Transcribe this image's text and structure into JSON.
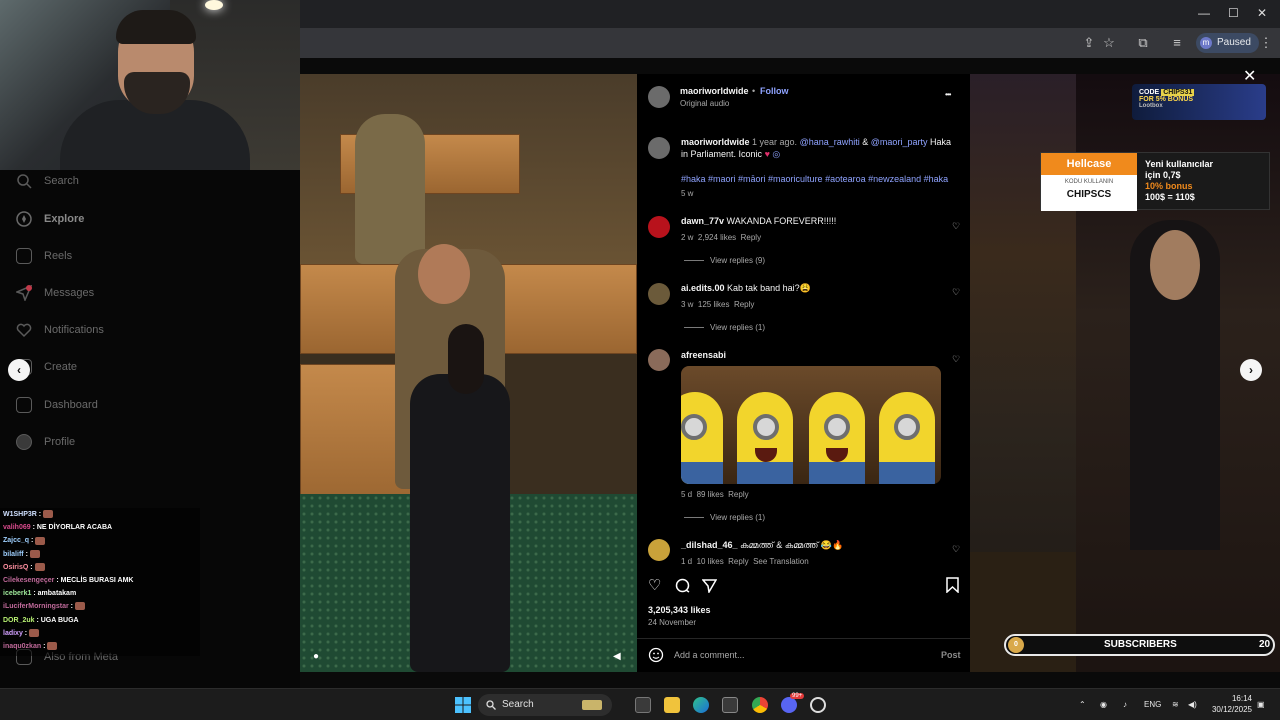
{
  "browser": {
    "window_controls": [
      "—",
      "☐",
      "✕"
    ],
    "profile_initial": "m",
    "profile_status": "Paused"
  },
  "sidebar": {
    "items": [
      {
        "label": "Search",
        "icon": "search-icon"
      },
      {
        "label": "Explore",
        "icon": "compass-icon"
      },
      {
        "label": "Reels",
        "icon": "reels-icon"
      },
      {
        "label": "Messages",
        "icon": "messages-icon"
      },
      {
        "label": "Notifications",
        "icon": "heart-icon"
      },
      {
        "label": "Create",
        "icon": "plus-icon"
      },
      {
        "label": "Dashboard",
        "icon": "dashboard-icon"
      },
      {
        "label": "Profile",
        "icon": "profile-icon"
      }
    ],
    "footer": "Also from Meta"
  },
  "chat": [
    {
      "user": "W1SHP3R",
      "color": "#cfe0ff",
      "msg": ""
    },
    {
      "user": "valih069",
      "color": "#d84a8c",
      "msg": "NE DİYORLAR ACABA"
    },
    {
      "user": "Zajcc_q",
      "color": "#9fd0ff",
      "msg": ""
    },
    {
      "user": "bilaliff",
      "color": "#9fd0ff",
      "msg": ""
    },
    {
      "user": "OsirisQ",
      "color": "#ff8fa0",
      "msg": ""
    },
    {
      "user": "Cilekesengeçer",
      "color": "#c06a9a",
      "msg": "MECLİS BURASI AMK"
    },
    {
      "user": "iceberk1",
      "color": "#9fe89a",
      "msg": "ambatakam"
    },
    {
      "user": "iLuciferMorningstar",
      "color": "#c06a9a",
      "msg": ""
    },
    {
      "user": "DOR_2uk",
      "color": "#b7f072",
      "msg": "UGA BUGA"
    },
    {
      "user": "ladixy",
      "color": "#d2a0ff",
      "msg": ""
    },
    {
      "user": "inaqu0zkan",
      "color": "#c06a9a",
      "msg": ""
    }
  ],
  "post": {
    "author": "maoriworldwide",
    "separator": "•",
    "follow_label": "Follow",
    "audio": "Original audio",
    "more": "•••",
    "caption_user": "maoriworldwide",
    "caption_time": "1 year ago.",
    "mention1": "@hana_rawhiti",
    "amp": "&",
    "mention2": "@maori_party",
    "caption_text": "Haka",
    "caption_text2": "in Parliament. Iconic",
    "hashtags": "#haka #maori #māori #maoriculture #aotearoa #newzealand #haka",
    "caption_age": "5 w",
    "likes": "3,205,343 likes",
    "date": "24 November",
    "comment_placeholder": "Add a comment...",
    "post_label": "Post"
  },
  "comments": [
    {
      "user": "dawn_77v",
      "text": "WAKANDA FOREVERR!!!!!",
      "age": "2 w",
      "likes": "2,924 likes",
      "reply": "Reply",
      "view_replies": "View replies (9)",
      "avatar_color": "#b8121c"
    },
    {
      "user": "ai.edits.00",
      "text": "Kab tak band hai?😩",
      "age": "3 w",
      "likes": "125 likes",
      "reply": "Reply",
      "view_replies": "View replies (1)",
      "avatar_color": "#6b5a3a"
    },
    {
      "user": "afreensabi",
      "text": "",
      "age": "5 d",
      "likes": "89 likes",
      "reply": "Reply",
      "view_replies": "View replies (1)",
      "avatar_color": "#8a6b5a"
    },
    {
      "user": "_dilshad_46_",
      "text": "കമ്മത്ത് & കമ്മത്ത് 😂🔥",
      "age": "1 d",
      "likes": "10 likes",
      "reply": "Reply",
      "translation": "See Translation",
      "avatar_color": "#c9a23a"
    }
  ],
  "ads": {
    "code_top": "CODE",
    "code_value": "CHIPS31",
    "code_sub": "FOR 5% BONUS",
    "code_brand": "Lootbox",
    "hell_brand": "Hellcase",
    "hell_code_label": "KODU KULLANIN",
    "hell_code": "CHIPSCS",
    "hell_line1": "Yeni kullanıcılar",
    "hell_line2": "için 0,7$",
    "hell_line3": "10% bonus",
    "hell_line4": "100$ = 110$"
  },
  "subscribers": {
    "start": "0",
    "label": "SUBSCRIBERS",
    "goal": "20",
    "progress": 0
  },
  "taskbar": {
    "search_label": "Search",
    "language": "ENG",
    "time": "16:14",
    "date": "30/12/2025",
    "discord_badge": "99+"
  }
}
